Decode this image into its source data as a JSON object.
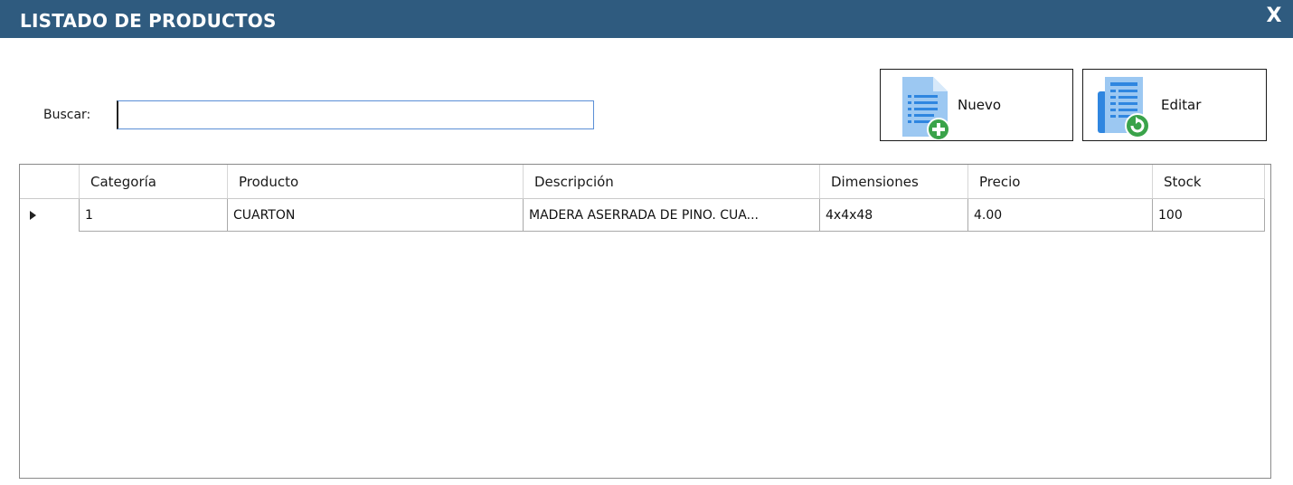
{
  "window": {
    "title": "LISTADO DE PRODUCTOS",
    "close_label": "X"
  },
  "search": {
    "label": "Buscar:",
    "value": "",
    "placeholder": ""
  },
  "toolbar": {
    "new_label": "Nuevo",
    "edit_label": "Editar",
    "new_icon": "document-add-icon",
    "edit_icon": "document-refresh-icon"
  },
  "table": {
    "columns": [
      "Categoría",
      "Producto",
      "Descripción",
      "Dimensiones",
      "Precio",
      "Stock"
    ],
    "rows": [
      [
        "1",
        "CUARTON",
        "MADERA ASERRADA DE PINO. CUA...",
        "4x4x48",
        "4.00",
        "100"
      ]
    ]
  },
  "colors": {
    "titlebar": "#2f5b7f",
    "accent_green": "#3aa34a",
    "icon_blue": "#2f86e0"
  }
}
